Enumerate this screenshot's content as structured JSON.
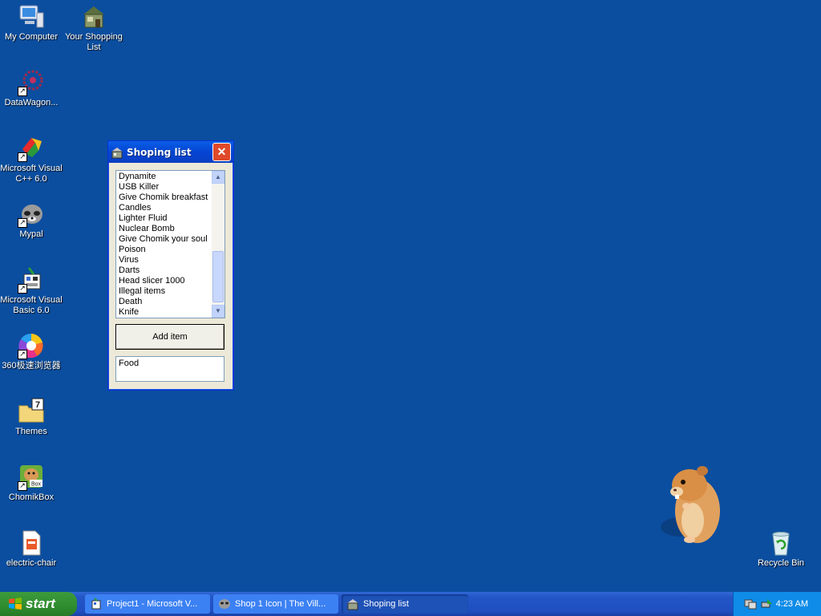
{
  "desktop": {
    "icons": [
      {
        "label": "My Computer"
      },
      {
        "label": "Your Shopping List"
      },
      {
        "label": "DataWagon..."
      },
      {
        "label": "Microsoft Visual C++ 6.0"
      },
      {
        "label": "Mypal"
      },
      {
        "label": "Microsoft Visual Basic 6.0"
      },
      {
        "label": "360极速浏览器"
      },
      {
        "label": "Themes"
      },
      {
        "label": "ChomikBox"
      },
      {
        "label": "electric-chair"
      },
      {
        "label": "Recycle Bin"
      }
    ],
    "background_color": "#0b4e9f"
  },
  "window": {
    "title": "Shoping list",
    "close_glyph": "✕",
    "list_items": [
      "Dynamite",
      "USB Killer",
      "Give Chomik breakfast",
      "Candles",
      "Lighter Fluid",
      "Nuclear Bomb",
      "Give Chomik your soul",
      "Poison",
      "Virus",
      "Darts",
      "Head slicer 1000",
      "Illegal items",
      "Death",
      "Knife"
    ],
    "add_button_label": "Add item",
    "input_value": "Food"
  },
  "taskbar": {
    "start_label": "start",
    "tasks": [
      {
        "label": "Project1 - Microsoft V..."
      },
      {
        "label": "Shop 1 Icon | The Vill..."
      },
      {
        "label": "Shoping list"
      }
    ],
    "clock": "4:23 AM"
  }
}
